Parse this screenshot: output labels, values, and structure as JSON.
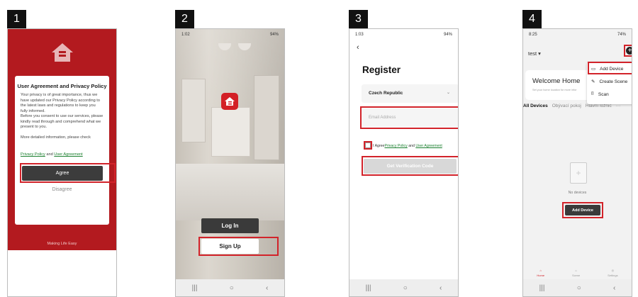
{
  "steps": [
    "1",
    "2",
    "3",
    "4"
  ],
  "screen1": {
    "dialog_title": "User Agreement and Privacy Policy",
    "body_lines": [
      "Your privacy is of great importance, thus we",
      "have updated our Privacy Policy according to",
      "the latest laws and regulations to keep you",
      "fully informed.",
      "Before you consent to use our services, please",
      "kindly read through and comprehend what we",
      "present to you."
    ],
    "more_info": "More detailed information, please check",
    "privacy_link": "Privacy Policy",
    "and": "and",
    "agreement_link": "User Agreement",
    "agree_label": "Agree",
    "disagree_label": "Disagree",
    "tagline": "Making Life Easy"
  },
  "screen2": {
    "time": "1:02",
    "status_right": "94%",
    "login_label": "Log In",
    "signup_label": "Sign Up"
  },
  "screen3": {
    "time": "1:03",
    "status_right": "94%",
    "back_icon": "chevron-left-icon",
    "title": "Register",
    "country": "Czech Republic",
    "email_placeholder": "Email Address",
    "agree_prefix": "I Agree",
    "privacy_link": "Privacy Policy",
    "and": "and",
    "agreement_link": "User Agreement",
    "verify_label": "Get Verification Code"
  },
  "screen4": {
    "time": "8:25",
    "status_right": "74%",
    "home_name": "test ▾",
    "welcome_title": "Welcome Home",
    "welcome_subtitle": "Set your home location for more infor",
    "tabs": [
      "All Devices",
      "Obývací pokoj",
      "Hlavní ložnic",
      "···"
    ],
    "menu": [
      "Add Device",
      "Create Scene",
      "Scan"
    ],
    "no_devices": "No devices",
    "add_device_label": "Add Device",
    "bottom_tabs": [
      "Home",
      "Scene",
      "Settings"
    ]
  },
  "accent_color": "#d32026"
}
